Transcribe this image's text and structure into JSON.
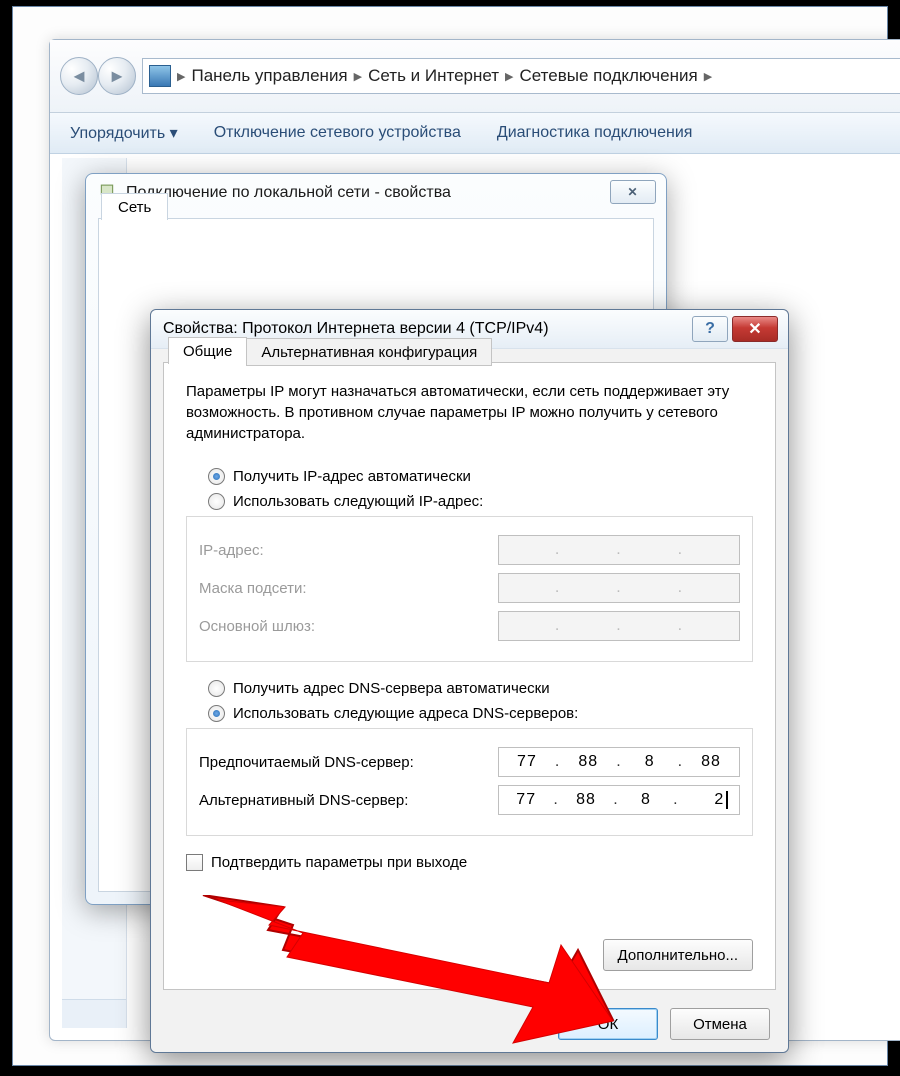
{
  "explorer": {
    "breadcrumbs": [
      "Панель управления",
      "Сеть и Интернет",
      "Сетевые подключения"
    ],
    "toolbar": {
      "organize": "Упорядочить ▾",
      "disable": "Отключение сетевого устройства",
      "diagnose": "Диагностика подключения"
    }
  },
  "props": {
    "title": "Подключение по локальной сети - свойства",
    "tab_network": "Сеть"
  },
  "ipv4": {
    "title": "Свойства: Протокол Интернета версии 4 (TCP/IPv4)",
    "tab_general": "Общие",
    "tab_alt": "Альтернативная конфигурация",
    "description": "Параметры IP могут назначаться автоматически, если сеть поддерживает эту возможность. В противном случае параметры IP можно получить у сетевого администратора.",
    "radio_ip_auto": "Получить IP-адрес автоматически",
    "radio_ip_manual": "Использовать следующий IP-адрес:",
    "label_ip": "IP-адрес:",
    "label_mask": "Маска подсети:",
    "label_gateway": "Основной шлюз:",
    "radio_dns_auto": "Получить адрес DNS-сервера автоматически",
    "radio_dns_manual": "Использовать следующие адреса DNS-серверов:",
    "label_dns_pref": "Предпочитаемый DNS-сервер:",
    "label_dns_alt": "Альтернативный DNS-сервер:",
    "dns_pref": [
      "77",
      "88",
      "8",
      "88"
    ],
    "dns_alt": [
      "77",
      "88",
      "8",
      "2"
    ],
    "checkbox_validate": "Подтвердить параметры при выходе",
    "btn_advanced": "Дополнительно...",
    "btn_ok": "ОК",
    "btn_cancel": "Отмена",
    "help_symbol": "?",
    "close_symbol": "✕"
  }
}
